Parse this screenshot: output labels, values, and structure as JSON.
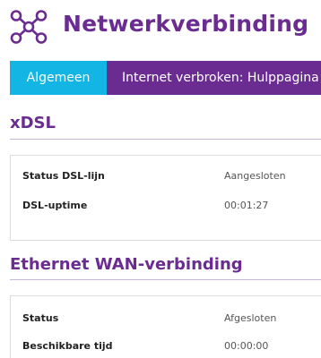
{
  "header": {
    "title": "Netwerkverbinding",
    "logo_icon": "network-nodes-icon"
  },
  "tabs": [
    {
      "label": "Algemeen",
      "active": true
    },
    {
      "label": "Internet verbroken: Hulppagina",
      "active": false
    }
  ],
  "sections": [
    {
      "title": "xDSL",
      "rows": [
        {
          "label": "Status DSL-lijn",
          "value": "Aangesloten"
        },
        {
          "label": "DSL-uptime",
          "value": "00:01:27"
        }
      ]
    },
    {
      "title": "Ethernet WAN-verbinding",
      "rows": [
        {
          "label": "Status",
          "value": "Afgesloten"
        },
        {
          "label": "Beschikbare tijd",
          "value": "00:00:00"
        }
      ]
    }
  ],
  "colors": {
    "brand_purple": "#6a2c91",
    "tab_active": "#12b5e3",
    "rule": "#c9b6d8"
  }
}
